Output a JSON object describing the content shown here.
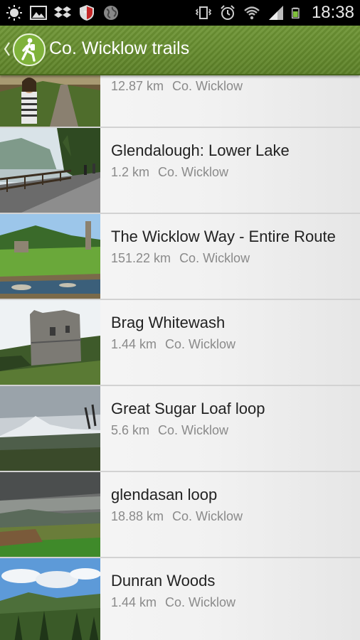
{
  "status_bar": {
    "time": "18:38",
    "left_icons": [
      "brightness-icon",
      "image-icon",
      "dropbox-icon",
      "shield-icon",
      "globe-icon"
    ],
    "right_icons": [
      "vibrate-icon",
      "alarm-icon",
      "wifi-icon",
      "signal-icon",
      "battery-icon"
    ]
  },
  "action_bar": {
    "title": "Co. Wicklow trails",
    "accent": "#6a8f30"
  },
  "trails": [
    {
      "name": "",
      "distance": "12.87 km",
      "county": "Co. Wicklow"
    },
    {
      "name": "Glendalough: Lower Lake",
      "distance": "1.2 km",
      "county": "Co. Wicklow"
    },
    {
      "name": "The Wicklow Way - Entire Route",
      "distance": "151.22 km",
      "county": "Co. Wicklow"
    },
    {
      "name": "Brag Whitewash",
      "distance": "1.44 km",
      "county": "Co. Wicklow"
    },
    {
      "name": "Great Sugar Loaf loop",
      "distance": "5.6 km",
      "county": "Co. Wicklow"
    },
    {
      "name": "glendasan loop",
      "distance": "18.88 km",
      "county": "Co. Wicklow"
    },
    {
      "name": "Dunran Woods",
      "distance": "1.44 km",
      "county": "Co. Wicklow"
    }
  ]
}
